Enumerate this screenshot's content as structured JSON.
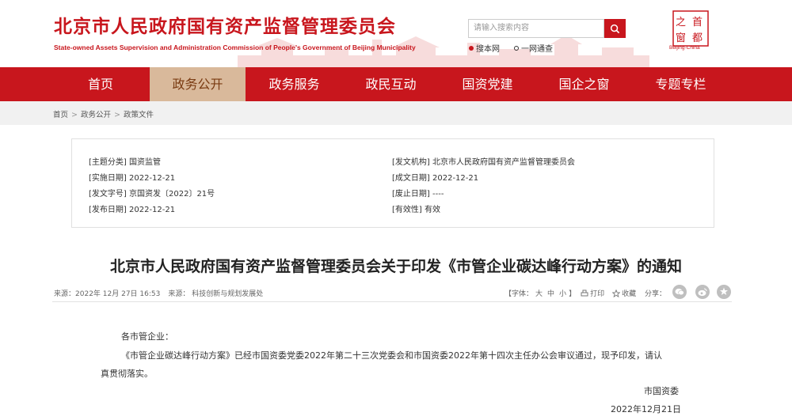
{
  "header": {
    "title": "北京市人民政府国有资产监督管理委员会",
    "subtitle": "State-owned Assets Supervision and Administration Commission of People's Government of Beijing Municipality",
    "search_placeholder": "请输入搜索内容",
    "quick_links": [
      "搜本网",
      "一网通查"
    ],
    "logo_text": [
      "首",
      "都",
      "之",
      "窗"
    ],
    "logo_caption": "Beijing-China"
  },
  "nav": {
    "items": [
      "首页",
      "政务公开",
      "政务服务",
      "政民互动",
      "国资党建",
      "国企之窗",
      "专题专栏"
    ],
    "active_index": 1
  },
  "breadcrumb": [
    "首页",
    "政务公开",
    "政策文件"
  ],
  "info": {
    "left": [
      {
        "label": "[主题分类]",
        "value": "国资监管"
      },
      {
        "label": "[实施日期]",
        "value": "2022-12-21"
      },
      {
        "label": "[发文字号]",
        "value": "京国资发〔2022〕21号"
      },
      {
        "label": "[发布日期]",
        "value": "2022-12-21"
      }
    ],
    "right": [
      {
        "label": "[发文机构]",
        "value": "北京市人民政府国有资产监督管理委员会"
      },
      {
        "label": "[成文日期]",
        "value": "2022-12-21"
      },
      {
        "label": "[废止日期]",
        "value": "----"
      },
      {
        "label": "[有效性]",
        "value": "有效"
      }
    ]
  },
  "document": {
    "title": "北京市人民政府国有资产监督管理委员会关于印发《市管企业碳达峰行动方案》的通知",
    "source_label": "来源：",
    "date": "2022年 12月 27日 16:53",
    "department": "来源：  科技创新与规划发展处",
    "font_label": "【字体：",
    "font_sizes": [
      "大",
      "中",
      "小"
    ],
    "font_close": "】",
    "print_label": "打印",
    "favorite_label": "收藏",
    "share_label": "分享：",
    "share_icons": [
      "wechat-icon",
      "weibo-icon",
      "other-share-icon"
    ],
    "salutation": "各市管企业：",
    "paragraph_line1": "《市管企业碳达峰行动方案》已经市国资委党委2022年第二十三次党委会和市国资委2022年第十四次主任办公会审议通过，现予印发，请认",
    "paragraph_line2": "真贯彻落实。",
    "signature": "市国资委",
    "sign_date": "2022年12月21日"
  },
  "colors": {
    "brand_red": "#c8161d",
    "nav_active_bg": "#d9b99b",
    "breadcrumb_bg": "#f1f1f1"
  }
}
